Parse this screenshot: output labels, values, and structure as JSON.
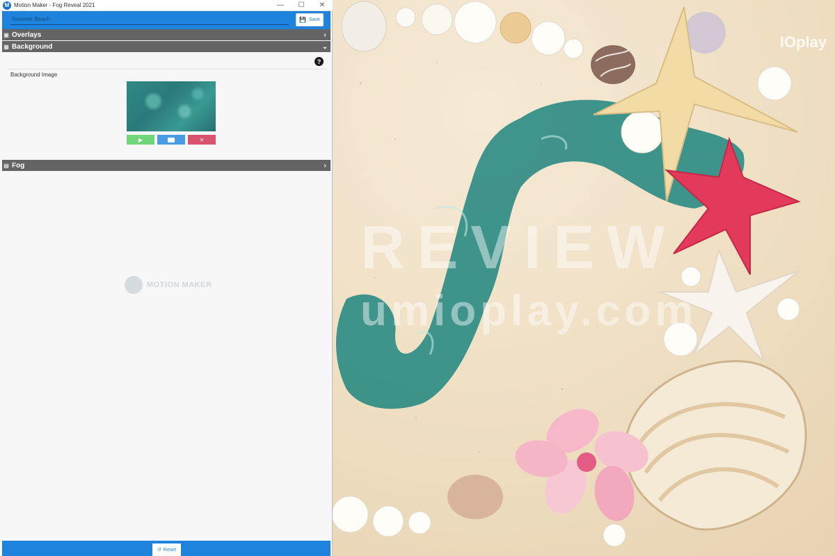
{
  "window": {
    "title": "Motion Maker - Fog Reveal 2021",
    "minimize_icon": "minimize-icon",
    "maximize_icon": "maximize-icon",
    "close_icon": "close-icon"
  },
  "topbar": {
    "project_name_value": "Summer Beach",
    "save_label": "Save",
    "save_icon": "floppy-disk-icon"
  },
  "sections": {
    "overlays": {
      "label": "Overlays",
      "icon": "layers-icon",
      "expanded": false
    },
    "background": {
      "label": "Background",
      "icon": "image-icon",
      "expanded": true
    },
    "fog": {
      "label": "Fog",
      "icon": "fog-icon",
      "expanded": false
    }
  },
  "background_panel": {
    "image_label": "Background Image",
    "help_glyph": "?",
    "buttons": [
      {
        "name": "play",
        "glyph": "▶",
        "color": "#6fd67a"
      },
      {
        "name": "open-folder",
        "glyph": "📂",
        "color": "#4a9be6"
      },
      {
        "name": "clear",
        "glyph": "✕",
        "color": "#d9536e"
      }
    ]
  },
  "watermark": {
    "text": "MOTION MAKER"
  },
  "bottombar": {
    "reset_label": "Reset",
    "reset_icon": "undo-icon"
  },
  "preview": {
    "brand_text": "IOplay",
    "watermark_line1": "REVIEW",
    "watermark_line2": "umioplay.com"
  },
  "colors": {
    "accent_blue": "#1e83dc",
    "section_header": "#646464",
    "panel_bg": "#f7f7f7",
    "play_green": "#6fd67a",
    "folder_blue": "#4a9be6",
    "clear_red": "#d9536e"
  }
}
